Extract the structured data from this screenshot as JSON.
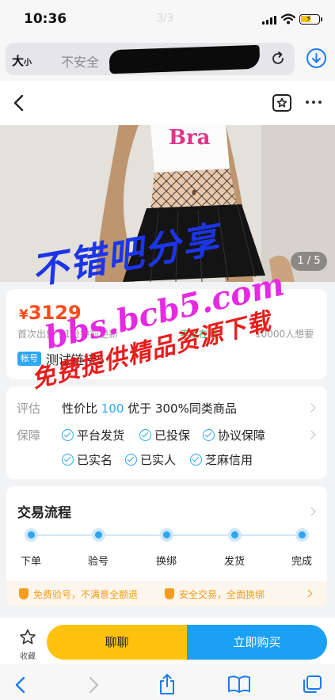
{
  "status_bar": {
    "time": "10:36",
    "page_indicator": "3/3"
  },
  "browser": {
    "text_size_label": "大",
    "text_size_small": "小",
    "url_text": "不安全"
  },
  "gallery": {
    "counter": "1 / 5"
  },
  "listing": {
    "price_symbol": "¥",
    "price_value": "3129",
    "meta": "首次出售 | 1分钟前更新",
    "seller_status": "卖家在线",
    "wants": "10000人想要",
    "tag": "帐号",
    "title": "测试链接5"
  },
  "guarantee": {
    "rating_label": "评估",
    "rating_prefix": "性价比 ",
    "rating_value": "100",
    "rating_suffix": " 优于 300%同类商品",
    "guarantee_label": "保障",
    "items": [
      "平台发货",
      "已投保",
      "协议保障",
      "已实名",
      "已实人",
      "芝麻信用"
    ]
  },
  "flow": {
    "title": "交易流程",
    "steps": [
      "下单",
      "验号",
      "换绑",
      "发货",
      "完成"
    ],
    "notices": [
      "免费验号，不满意全额退",
      "安全交易，全面换绑"
    ]
  },
  "actions": {
    "favorite_label": "收藏",
    "chat_label": "聊聊",
    "buy_label": "立即购买"
  },
  "watermark": {
    "line1": "不错吧分享",
    "line2": "bbs.bcb5.com",
    "line3": "免费提供精品资源下载"
  },
  "colors": {
    "accent_blue": "#2ea7f2",
    "price_red": "#ff4a1a",
    "chat_yellow": "#ffc20e",
    "buy_blue": "#1aa0f4",
    "notice_orange": "#f39c1f"
  }
}
